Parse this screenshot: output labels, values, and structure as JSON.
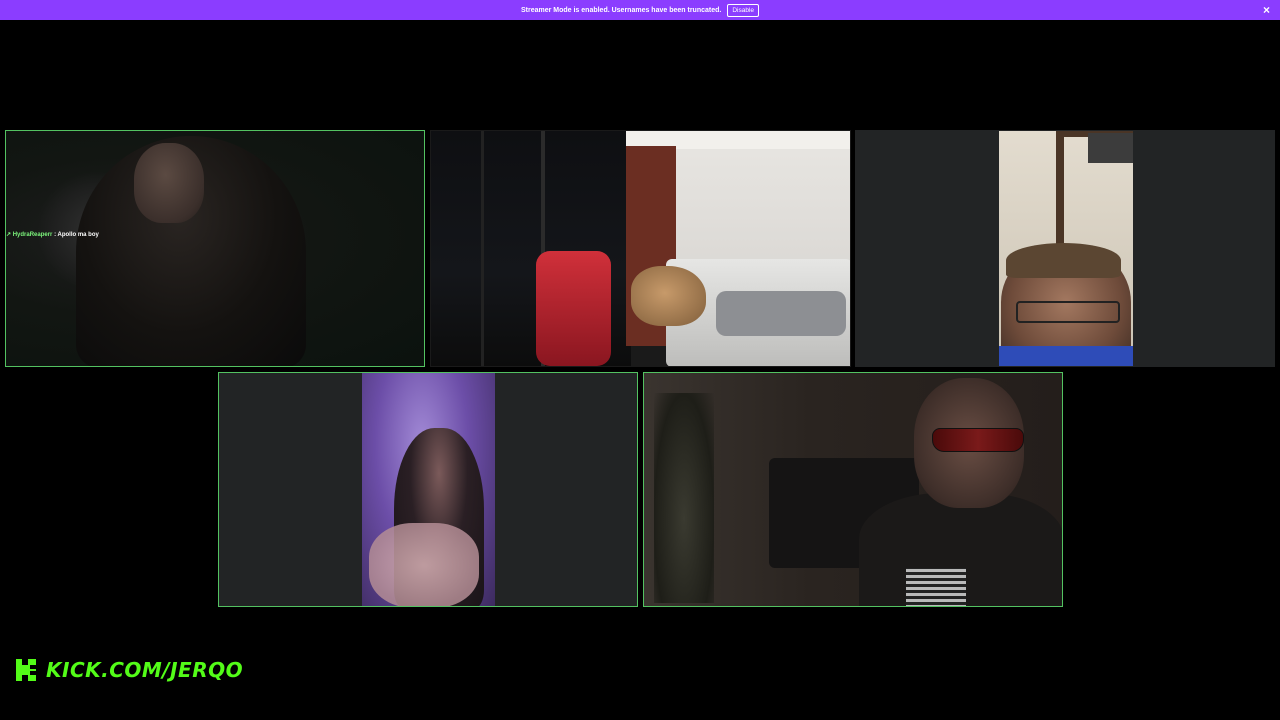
{
  "banner": {
    "message": "Streamer Mode is enabled. Usernames have been truncated.",
    "disable_label": "Disable",
    "close_glyph": "×",
    "color": "#8b3dff"
  },
  "tiles": [
    {
      "id": "participant-1",
      "active": true,
      "chat_overlay": {
        "icon": "mod-icon",
        "username": "HydraReaperr",
        "separator": ":",
        "message": "Apollo ma boy"
      }
    },
    {
      "id": "participant-2",
      "active": false
    },
    {
      "id": "participant-3",
      "active": false
    },
    {
      "id": "participant-4",
      "active": true
    },
    {
      "id": "participant-5",
      "active": true
    }
  ],
  "branding": {
    "icon": "kick-logo-icon",
    "url_text": "KICK.COM/JERQO",
    "accent": "#53fc18"
  },
  "active_border_color": "#53c261"
}
